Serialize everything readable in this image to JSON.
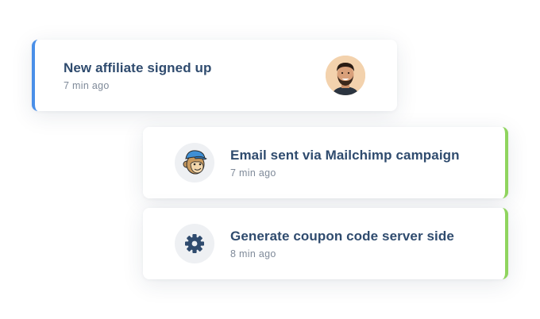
{
  "notifications": [
    {
      "title": "New affiliate signed up",
      "time": "7 min ago",
      "icon": "user-avatar",
      "accent": "#4a8fe8"
    },
    {
      "title": "Email sent via Mailchimp campaign",
      "time": "7 min ago",
      "icon": "mailchimp-icon",
      "accent": "#8fd45e"
    },
    {
      "title": "Generate coupon code server side",
      "time": "8 min ago",
      "icon": "gear-icon",
      "accent": "#8fd45e"
    }
  ]
}
